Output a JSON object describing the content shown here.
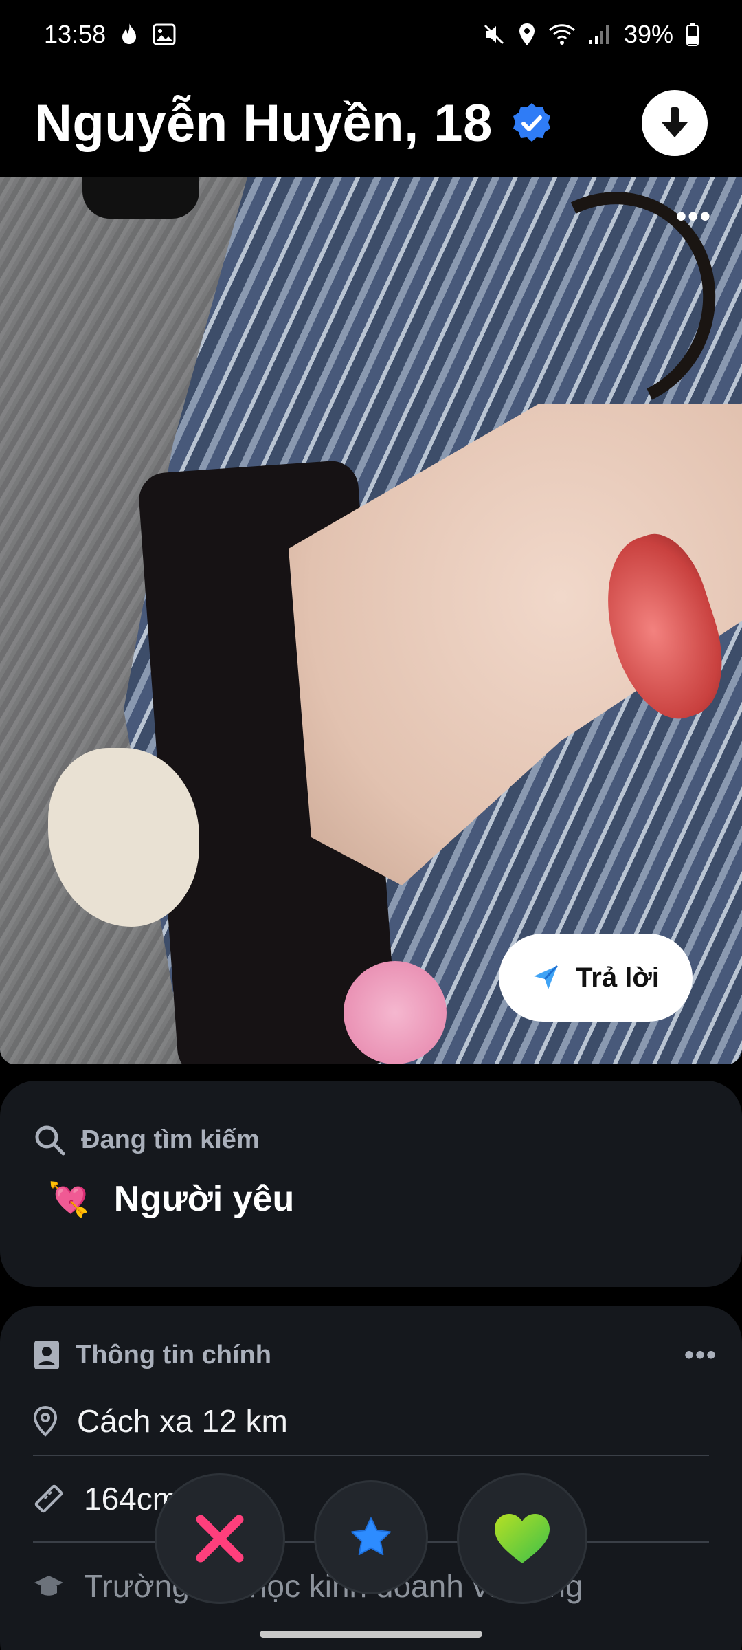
{
  "status_bar": {
    "time": "13:58",
    "battery": "39%",
    "icons": [
      "flame-notification-icon",
      "gallery-icon",
      "mute-icon",
      "location-icon",
      "wifi-icon",
      "signal-icon",
      "battery-icon"
    ]
  },
  "profile": {
    "name_age": "Nguyễn Huyền, 18",
    "verified": true
  },
  "photo": {
    "reply_label": "Trả lời"
  },
  "looking_for": {
    "title": "Đang tìm kiếm",
    "value": "Người yêu",
    "emoji": "💘"
  },
  "main_info": {
    "title": "Thông tin chính",
    "rows": [
      {
        "icon": "location-pin-icon",
        "text": "Cách xa 12 km"
      },
      {
        "icon": "ruler-icon",
        "text": "164cm"
      },
      {
        "icon": "graduation-cap-icon",
        "text": "Trường đại học kinh doanh và công"
      }
    ]
  },
  "actions": {
    "nope": "nope",
    "super_like": "super-like",
    "like": "like"
  },
  "colors": {
    "background": "#000000",
    "card": "#15181d",
    "verified_blue": "#2f7cf6",
    "nope_pink": "#ff3f7c",
    "super_blue": "#2d8cff",
    "like_green": "#7ed321"
  }
}
